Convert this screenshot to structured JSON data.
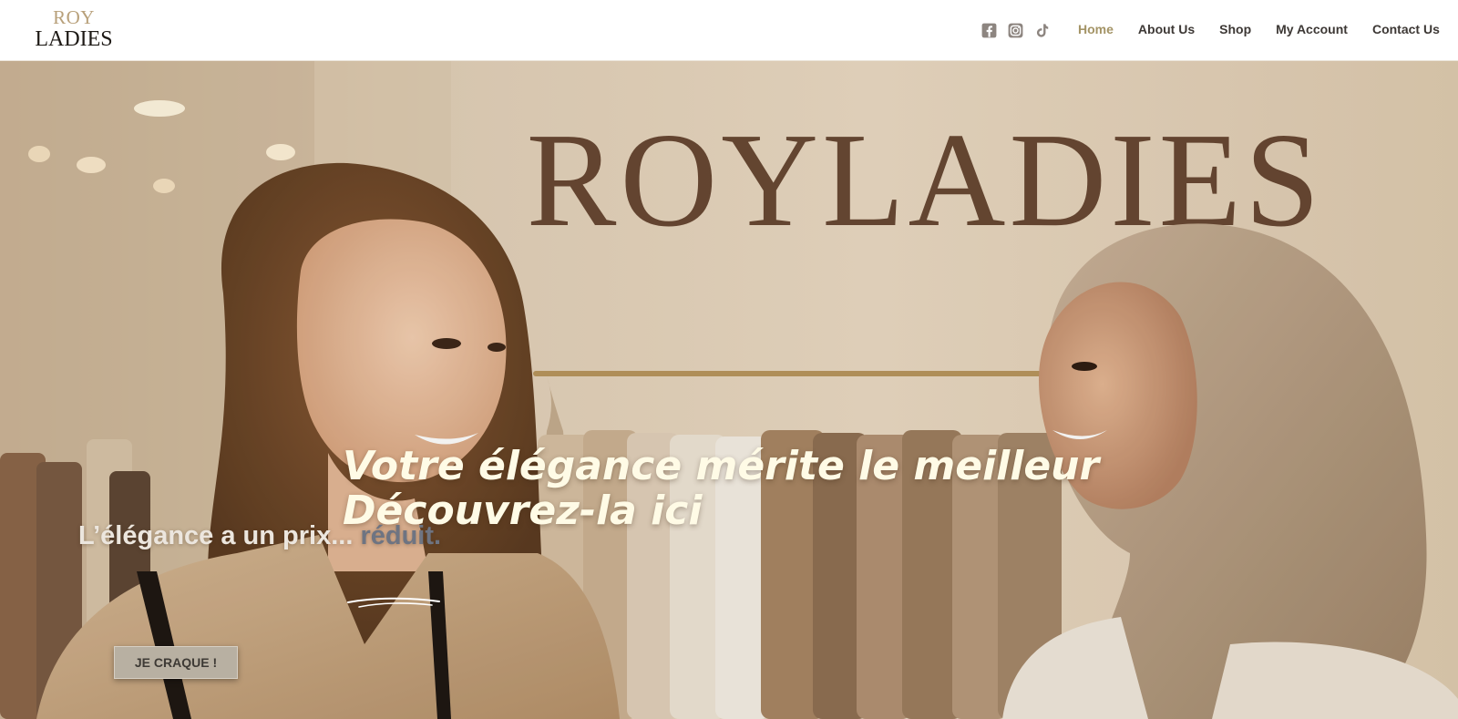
{
  "header": {
    "logo": {
      "line1": "ROY",
      "line2": "LADIES"
    },
    "socials": [
      {
        "icon": "facebook-icon"
      },
      {
        "icon": "instagram-icon"
      },
      {
        "icon": "tiktok-icon"
      }
    ],
    "nav": [
      {
        "label": "Home",
        "active": true
      },
      {
        "label": "About Us",
        "active": false
      },
      {
        "label": "Shop",
        "active": false
      },
      {
        "label": "My Account",
        "active": false
      },
      {
        "label": "Contact Us",
        "active": false
      }
    ]
  },
  "hero": {
    "image_sign_text": "ROYLADIES",
    "title": "Votre élégance mérite le meilleur Découvrez-la ici",
    "subtitle_prefix": "L’élégance a un prix... ",
    "subtitle_highlight": "réduit.",
    "cta_label": "JE CRAQUE !"
  },
  "colors": {
    "nav_active": "#a49466",
    "nav_text": "#3d3835",
    "logo_accent": "#b8a07a",
    "hero_title": "#fffbe6",
    "highlight": "#6e7482",
    "cta_bg": "#b8b0a2"
  }
}
